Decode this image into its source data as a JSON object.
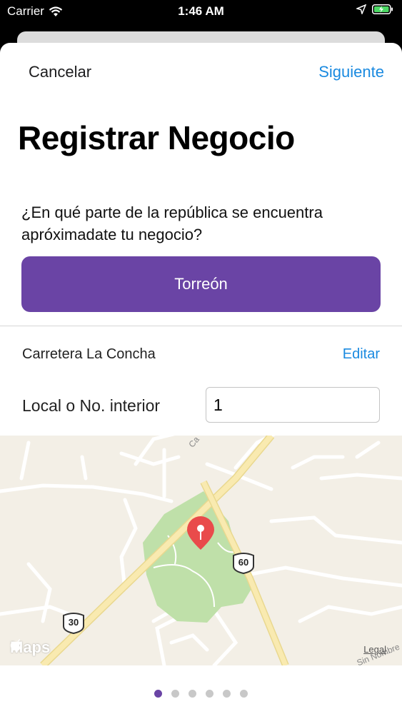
{
  "status_bar": {
    "carrier": "Carrier",
    "time": "1:46 AM",
    "icons": [
      "wifi-icon",
      "location-arrow-icon",
      "battery-charging-icon"
    ]
  },
  "nav": {
    "cancel_label": "Cancelar",
    "next_label": "Siguiente"
  },
  "page": {
    "title": "Registrar Negocio",
    "question": "¿En qué parte de la república se encuentra apróximadate tu negocio?",
    "city_button_label": "Torreón"
  },
  "address": {
    "street": "Carretera La Concha",
    "edit_label": "Editar"
  },
  "local": {
    "label": "Local o No. interior",
    "value": "1"
  },
  "map": {
    "route_shield_60": "60",
    "route_shield_30": "30",
    "street_label_top": "Ca",
    "street_label_bottom": "Sin Nombre",
    "logo": "Maps",
    "legal_label": "Legal"
  },
  "pager": {
    "total_pages": 6,
    "current_page": 1
  },
  "colors": {
    "accent": "#6a44a5",
    "link": "#1a8ae0",
    "pin": "#e94b4b",
    "park": "#bfe0a9",
    "road": "#f7e7a4"
  }
}
